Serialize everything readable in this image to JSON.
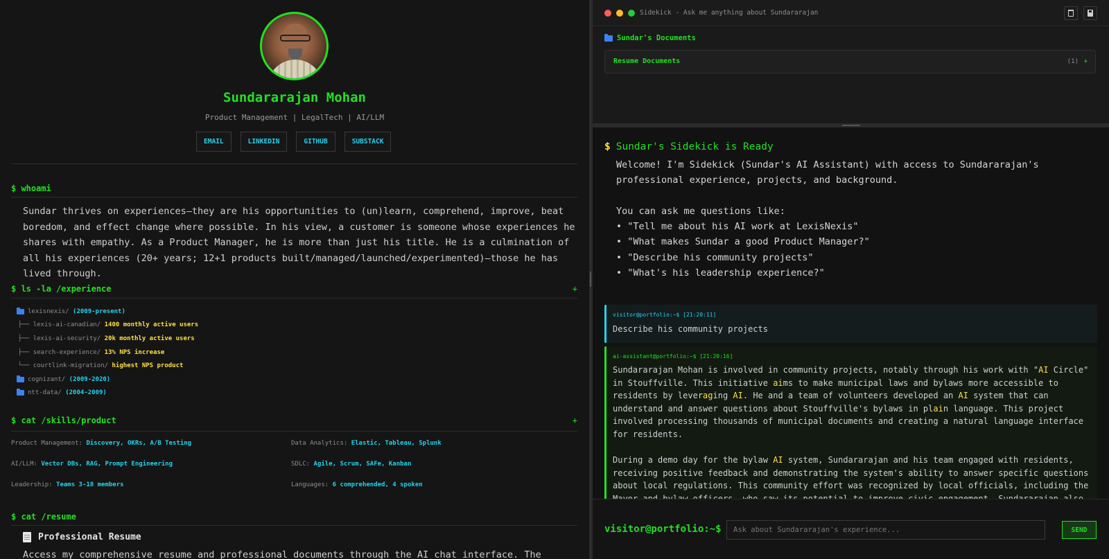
{
  "profile": {
    "name": "Sundararajan Mohan",
    "tagline": "Product Management | LegalTech | AI/LLM",
    "links": [
      "EMAIL",
      "LINKEDIN",
      "GITHUB",
      "SUBSTACK"
    ]
  },
  "whoami": {
    "title": "$ whoami",
    "text": "Sundar thrives on experiences—they are his opportunities to (un)learn, comprehend, improve, beat boredom, and effect change where possible. In his view, a customer is someone whose experiences he shares with empathy. As a Product Manager, he is more than just his title. He is a culmination of all his experiences (20+ years; 12+1 products built/managed/launched/experimented)—those he has lived through."
  },
  "experience": {
    "title": "$ ls -la /experience",
    "toggle": "+",
    "rows": [
      {
        "prefix": "",
        "name": "lexisnexis/",
        "detail": "(2009-present)",
        "style": "cyan",
        "folder": true
      },
      {
        "prefix": "├── ",
        "name": "lexis-ai-canadian/",
        "detail": "1400 monthly active users",
        "style": "yellow",
        "folder": false
      },
      {
        "prefix": "├── ",
        "name": "lexis-ai-security/",
        "detail": "20k monthly active users",
        "style": "yellow",
        "folder": false
      },
      {
        "prefix": "├── ",
        "name": "search-experience/",
        "detail": "13% NPS increase",
        "style": "yellow",
        "folder": false
      },
      {
        "prefix": "└── ",
        "name": "courtlink-migration/",
        "detail": "highest NPS product",
        "style": "yellow",
        "folder": false
      },
      {
        "prefix": "",
        "name": "cognizant/",
        "detail": "(2009-2020)",
        "style": "cyan",
        "folder": true
      },
      {
        "prefix": "",
        "name": "ntt-data/",
        "detail": "(2004-2009)",
        "style": "cyan",
        "folder": true
      }
    ]
  },
  "skills": {
    "title": "$ cat /skills/product",
    "toggle": "+",
    "items": [
      {
        "label": "Product Management:",
        "value": "Discovery, OKRs, A/B Testing"
      },
      {
        "label": "Data Analytics:",
        "value": "Elastic, Tableau, Splunk"
      },
      {
        "label": "AI/LLM:",
        "value": "Vector DBs, RAG, Prompt Engineering"
      },
      {
        "label": "SDLC:",
        "value": "Agile, Scrum, SAFe, Kanban"
      },
      {
        "label": "Leadership:",
        "value": "Teams 3-18 members"
      },
      {
        "label": "Languages:",
        "value": "6 comprehended, 4 spoken"
      }
    ]
  },
  "resume": {
    "title": "$ cat /resume",
    "heading": "Professional Resume",
    "text": "Access my comprehensive resume and professional documents through the AI chat interface. The system can"
  },
  "window": {
    "title": "Sidekick - Ask me anything about Sundararajan",
    "dot_colors": [
      "#ff5f57",
      "#febc2e",
      "#28c840"
    ]
  },
  "documents": {
    "header": "Sundar's Documents",
    "row_label": "Resume Documents",
    "row_count": "(1)",
    "row_toggle": "+"
  },
  "chat": {
    "ready_prompt": "$",
    "ready_title": "Sundar's Sidekick is Ready",
    "welcome": "Welcome! I'm Sidekick (Sundar's AI Assistant) with access to Sundararajan's professional experience, projects, and background.\n\nYou can ask me questions like:",
    "examples": [
      "• \"Tell me about his AI work at LexisNexis\"",
      "• \"What makes Sundar a good Product Manager?\"",
      "• \"Describe his community projects\"",
      "• \"What's his leadership experience?\""
    ],
    "user_meta": "visitor@portfolio:~$ [21:20:11]",
    "user_text": "Describe his community projects",
    "ai_meta": "ai-assistant@portfolio:~$ [21:20:16]",
    "ai_p1": "Sundararajan Mohan is involved in community projects, notably through his work with \"AI Circle\" in Stouffville. This initiative aims to make municipal laws and bylaws more accessible to residents by leveraging AI. He and a team of volunteers developed an AI system that can understand and answer questions about Stouffville's bylaws in plain language. This project involved processing thousands of municipal documents and creating a natural language interface for residents.",
    "ai_p2": "During a demo day for the bylaw AI system, Sundararajan and his team engaged with residents, receiving positive feedback and demonstrating the system's ability to answer specific questions about local regulations. This community effort was recognized by local officials, including the Mayor and bylaw officers, who saw its potential to improve civic engagement. Sundararajan also highlights his personal"
  },
  "input": {
    "prompt": "visitor@portfolio:~$",
    "placeholder": "Ask about Sundararajan's experience...",
    "send_label": "SEND"
  }
}
